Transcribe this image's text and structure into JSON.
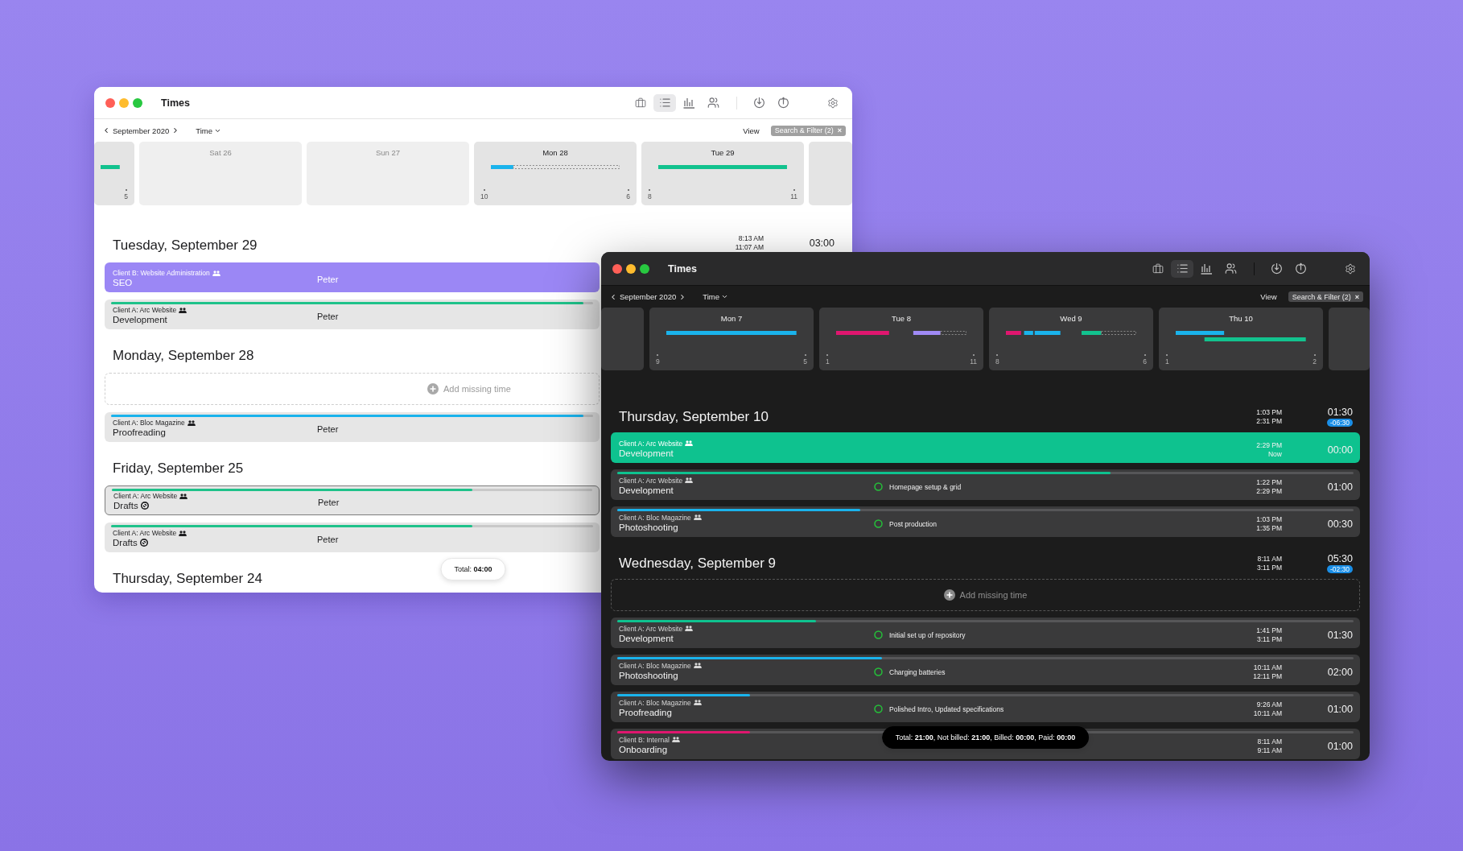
{
  "windows": [
    {
      "kind": "light",
      "title": "Times",
      "view_tabs": [
        {
          "selected": false
        },
        {
          "selected": true
        },
        {
          "selected": false
        },
        {
          "selected": false
        }
      ],
      "month": "September 2020",
      "mode": "Time",
      "view": "View",
      "filter": "Search & Filter (2)",
      "filter_clear": "×",
      "cards": [
        {
          "kind": "partial",
          "end_tick": "5"
        },
        {
          "kind": "day",
          "label": "Sat 26",
          "weekend": true
        },
        {
          "kind": "day",
          "label": "Sun 27",
          "weekend": true
        },
        {
          "kind": "day",
          "label": "Mon 28",
          "weekend": false,
          "start_tick": "10",
          "end_tick": "6"
        },
        {
          "kind": "day",
          "label": "Tue 29",
          "weekend": false,
          "start_tick": "8",
          "end_tick": "11"
        },
        {
          "kind": "partial"
        }
      ],
      "days": [
        {
          "title": "Tuesday, September 29",
          "start": "8:13 AM",
          "end": "11:07 AM",
          "total": "03:00",
          "rows": [
            {
              "client": "Client B: Website Administration",
              "task": "SEO",
              "person": "Peter",
              "selected": true,
              "focused": false,
              "not_billable": false,
              "color": "#9b87f5"
            },
            {
              "client": "Client A: Arc Website",
              "task": "Development",
              "person": "Peter",
              "selected": false,
              "focused": false,
              "not_billable": false,
              "color": "#1fc28a",
              "level": 0.98
            }
          ]
        },
        {
          "title": "Monday, September 28",
          "add_missing": "Add missing time",
          "rows": [
            {
              "client": "Client A: Bloc Magazine",
              "task": "Proofreading",
              "person": "Peter",
              "selected": false,
              "focused": false,
              "not_billable": false,
              "color": "#1ab3ec",
              "level": 0.98
            }
          ]
        },
        {
          "title": "Friday, September 25",
          "rows": [
            {
              "client": "Client A: Arc Website",
              "task": "Drafts",
              "person": "Peter",
              "selected": false,
              "focused": true,
              "not_billable": true,
              "color": "#1fc28a",
              "level": 0.75
            },
            {
              "client": "Client A: Arc Website",
              "task": "Drafts",
              "person": "Peter",
              "selected": false,
              "focused": false,
              "not_billable": true,
              "color": "#1fc28a",
              "level": 0.75
            }
          ]
        },
        {
          "title": "Thursday, September 24"
        }
      ],
      "total": "Total: **04:00**"
    },
    {
      "kind": "dark",
      "title": "Times",
      "view_tabs": [
        {
          "selected": false
        },
        {
          "selected": true
        },
        {
          "selected": false
        },
        {
          "selected": false
        }
      ],
      "month": "September 2020",
      "mode": "Time",
      "view": "View",
      "filter": "Search & Filter (2)",
      "filter_clear": "×",
      "cards": [
        {
          "kind": "partial"
        },
        {
          "kind": "day",
          "label": "Mon 7",
          "weekend": false,
          "start_tick": "9",
          "end_tick": "5"
        },
        {
          "kind": "day",
          "label": "Tue 8",
          "weekend": false,
          "start_tick": "1",
          "end_tick": "11"
        },
        {
          "kind": "day",
          "label": "Wed 9",
          "weekend": false,
          "start_tick": "8",
          "end_tick": "6"
        },
        {
          "kind": "day",
          "label": "Thu 10",
          "weekend": false,
          "start_tick": "1",
          "end_tick": "2"
        },
        {
          "kind": "partial"
        }
      ],
      "days": [
        {
          "title": "Thursday, September 10",
          "start": "1:03 PM",
          "end": "2:31 PM",
          "total": "01:30",
          "difference": "-06:30",
          "rows": [
            {
              "client": "Client A: Arc Website",
              "task": "Development",
              "start": "2:29 PM",
              "end": "Now",
              "duration": "00:00",
              "running": true,
              "color": "#0ec28f"
            },
            {
              "client": "Client A: Arc Website",
              "task": "Development",
              "note": "Homepage setup & grid",
              "start": "1:22 PM",
              "end": "2:29 PM",
              "duration": "01:00",
              "running": false,
              "color": "#0ec28f",
              "level": 0.67
            },
            {
              "client": "Client A: Bloc Magazine",
              "task": "Photoshooting",
              "note": "Post production",
              "start": "1:03 PM",
              "end": "1:35 PM",
              "duration": "00:30",
              "running": false,
              "color": "#1ab3ec",
              "level": 0.33
            }
          ]
        },
        {
          "title": "Wednesday, September 9",
          "start": "8:11 AM",
          "end": "3:11 PM",
          "total": "05:30",
          "difference": "-02:30",
          "add_missing": "Add missing time",
          "rows": [
            {
              "client": "Client A: Arc Website",
              "task": "Development",
              "note": "Initial set up of repository",
              "start": "1:41 PM",
              "end": "3:11 PM",
              "duration": "01:30",
              "running": false,
              "color": "#0ec28f",
              "level": 0.27
            },
            {
              "client": "Client A: Bloc Magazine",
              "task": "Photoshooting",
              "note": "Charging batteries",
              "start": "10:11 AM",
              "end": "12:11 PM",
              "duration": "02:00",
              "running": false,
              "color": "#1ab3ec",
              "level": 0.36
            },
            {
              "client": "Client A: Bloc Magazine",
              "task": "Proofreading",
              "note": "Polished Intro, Updated specifications",
              "start": "9:26 AM",
              "end": "10:11 AM",
              "duration": "01:00",
              "running": false,
              "color": "#1ab3ec",
              "level": 0.18
            },
            {
              "client": "Client B: Internal",
              "task": "Onboarding",
              "start": "8:11 AM",
              "end": "9:11 AM",
              "duration": "01:00",
              "running": false,
              "color": "#e0166f",
              "level": 0.18
            }
          ]
        }
      ],
      "total": "Total: **21:00**, Not billed: **21:00**, Billed: **00:00**, Paid: **00:00**"
    }
  ]
}
